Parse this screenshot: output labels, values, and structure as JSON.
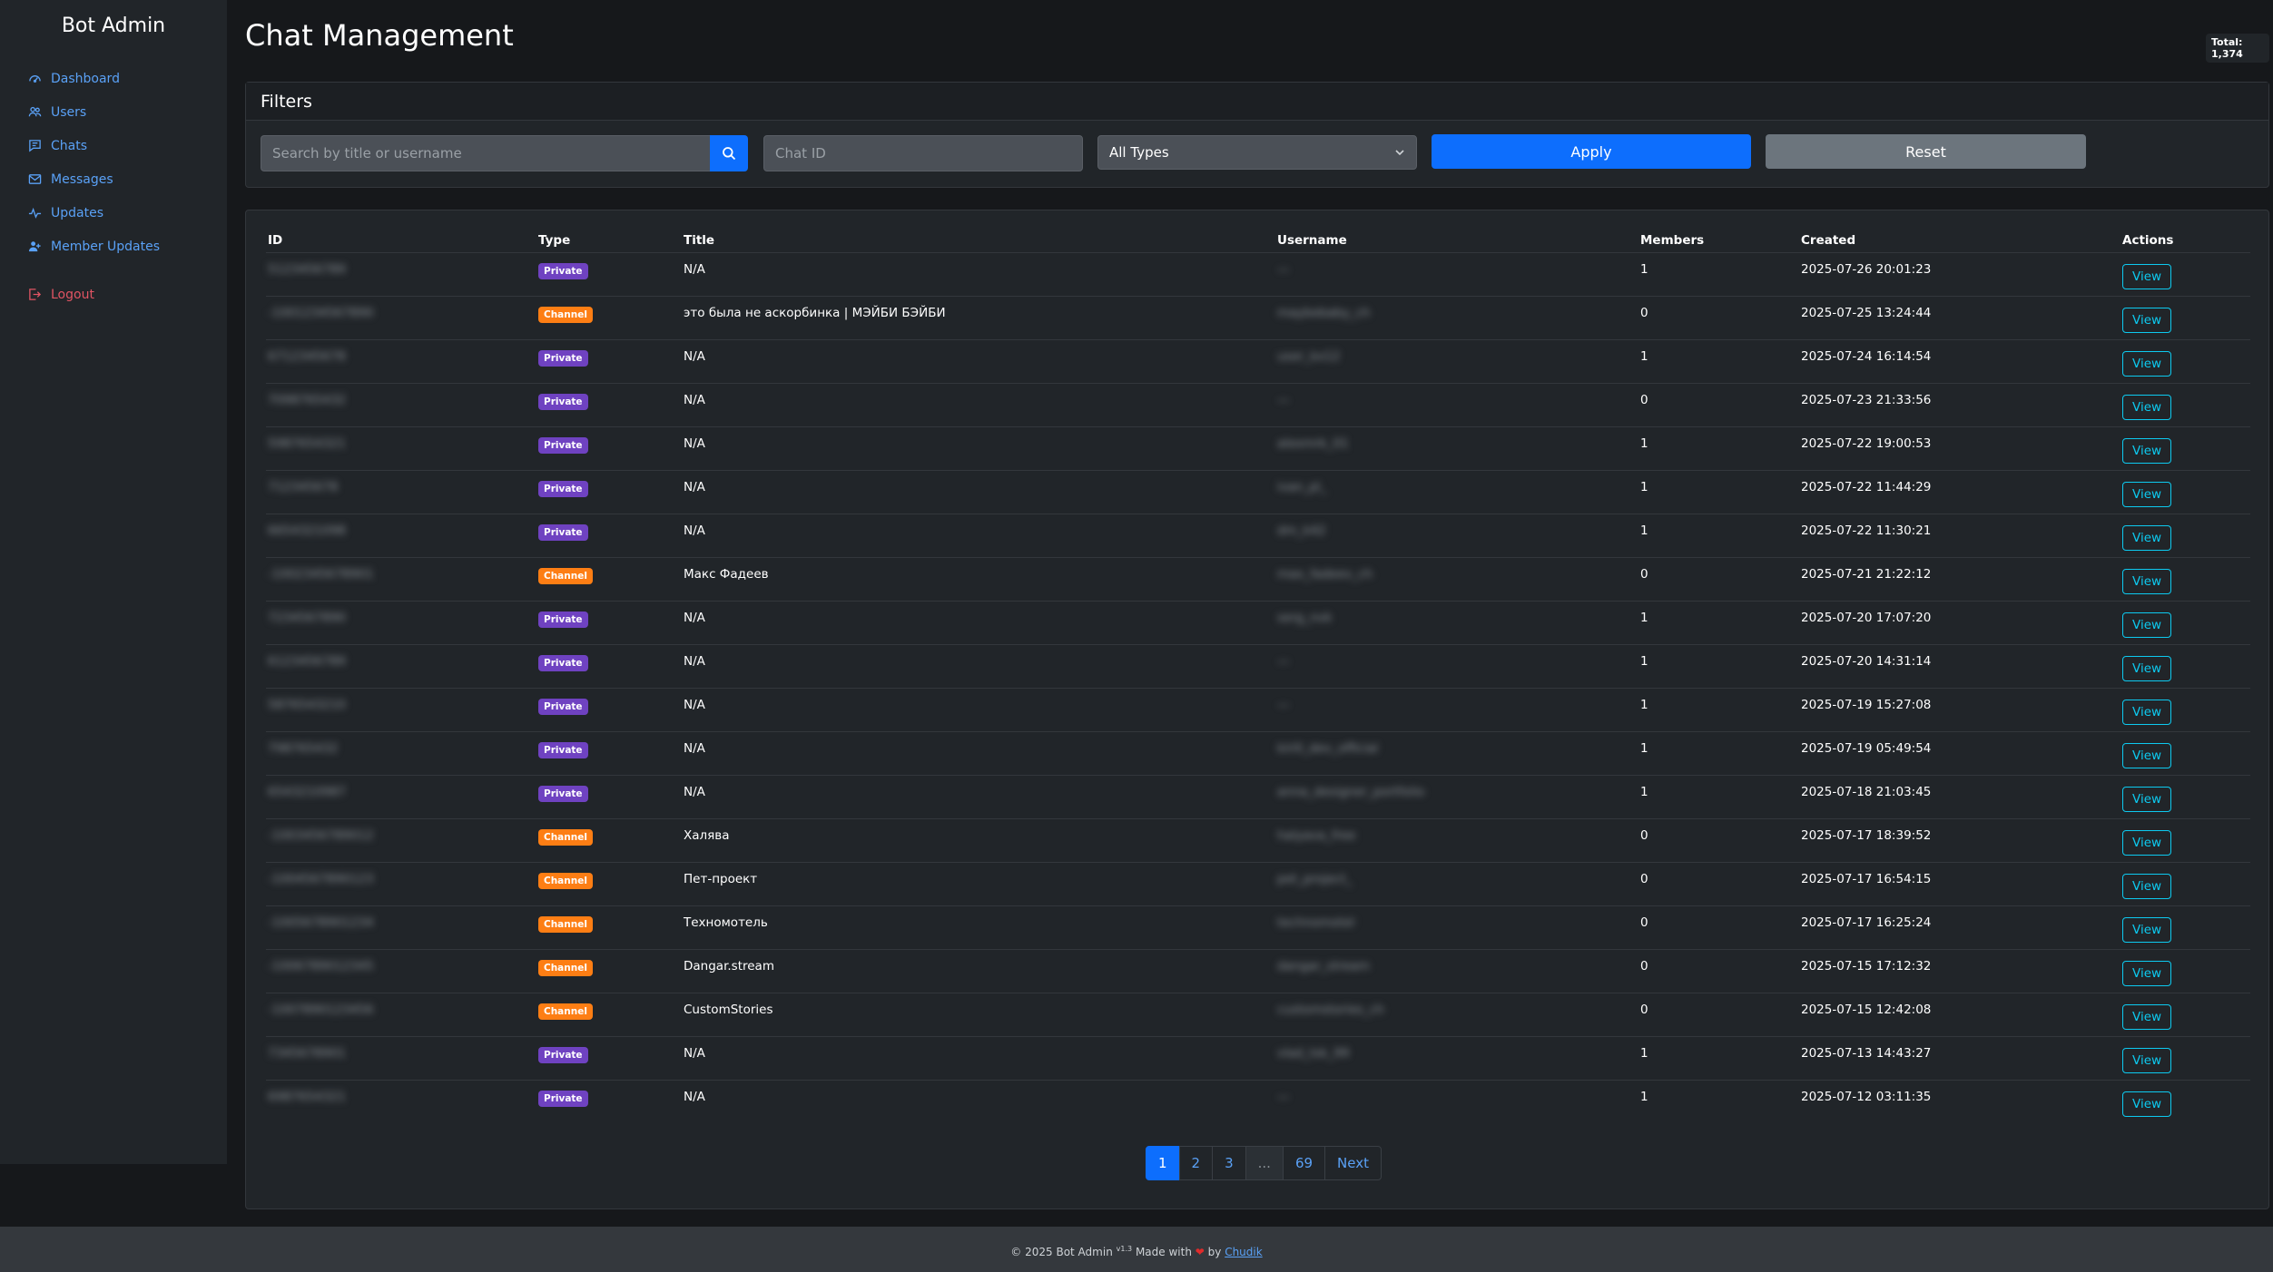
{
  "sidebar": {
    "brand": "Bot Admin",
    "items": [
      {
        "label": "Dashboard",
        "icon": "dashboard-icon"
      },
      {
        "label": "Users",
        "icon": "users-icon"
      },
      {
        "label": "Chats",
        "icon": "chats-icon"
      },
      {
        "label": "Messages",
        "icon": "envelope-icon"
      },
      {
        "label": "Updates",
        "icon": "pulse-icon"
      },
      {
        "label": "Member Updates",
        "icon": "member-icon"
      }
    ],
    "logout": {
      "label": "Logout",
      "icon": "logout-icon"
    }
  },
  "header": {
    "title": "Chat Management",
    "total": "Total: 1,374"
  },
  "filters": {
    "title": "Filters",
    "search_placeholder": "Search by title or username",
    "chat_id_placeholder": "Chat ID",
    "type_selected": "All Types",
    "apply_label": "Apply",
    "reset_label": "Reset"
  },
  "table": {
    "headers": [
      "ID",
      "Type",
      "Title",
      "Username",
      "Members",
      "Created",
      "Actions"
    ],
    "view_label": "View",
    "rows": [
      {
        "id": "5123456789",
        "type": "Private",
        "title": "N/A",
        "username": "—",
        "members": "1",
        "created": "2025-07-26 20:01:23"
      },
      {
        "id": "-1001234567890",
        "type": "Channel",
        "title": "это была не аскорбинка | МЭЙБИ БЭЙБИ",
        "username": "maybebaby_ch",
        "members": "0",
        "created": "2025-07-25 13:24:44"
      },
      {
        "id": "6712345678",
        "type": "Private",
        "title": "N/A",
        "username": "user_kx12",
        "members": "1",
        "created": "2025-07-24 16:14:54"
      },
      {
        "id": "7098765432",
        "type": "Private",
        "title": "N/A",
        "username": "—",
        "members": "0",
        "created": "2025-07-23 21:33:56"
      },
      {
        "id": "5987654321",
        "type": "Private",
        "title": "N/A",
        "username": "alexmrk_01",
        "members": "1",
        "created": "2025-07-22 19:00:53"
      },
      {
        "id": "712345678",
        "type": "Private",
        "title": "N/A",
        "username": "ivan_pl_",
        "members": "1",
        "created": "2025-07-22 11:44:29"
      },
      {
        "id": "6654321098",
        "type": "Private",
        "title": "N/A",
        "username": "dm_k42",
        "members": "1",
        "created": "2025-07-22 11:30:21"
      },
      {
        "id": "-1002345678901",
        "type": "Channel",
        "title": "Макс Фадеев",
        "username": "max_fadeev_ch",
        "members": "0",
        "created": "2025-07-21 21:22:12"
      },
      {
        "id": "7234567890",
        "type": "Private",
        "title": "N/A",
        "username": "serg_nvk",
        "members": "1",
        "created": "2025-07-20 17:07:20"
      },
      {
        "id": "6123456789",
        "type": "Private",
        "title": "N/A",
        "username": "—",
        "members": "1",
        "created": "2025-07-20 14:31:14"
      },
      {
        "id": "5876543210",
        "type": "Private",
        "title": "N/A",
        "username": "—",
        "members": "1",
        "created": "2025-07-19 15:27:08"
      },
      {
        "id": "798765432",
        "type": "Private",
        "title": "N/A",
        "username": "kirill_dev_official",
        "members": "1",
        "created": "2025-07-19 05:49:54"
      },
      {
        "id": "6543210987",
        "type": "Private",
        "title": "N/A",
        "username": "anna_designer_portfolio",
        "members": "1",
        "created": "2025-07-18 21:03:45"
      },
      {
        "id": "-1003456789012",
        "type": "Channel",
        "title": "Халява",
        "username": "halyava_free",
        "members": "0",
        "created": "2025-07-17 18:39:52"
      },
      {
        "id": "-1004567890123",
        "type": "Channel",
        "title": "Пет-проект",
        "username": "pet_project_",
        "members": "0",
        "created": "2025-07-17 16:54:15"
      },
      {
        "id": "-1005678901234",
        "type": "Channel",
        "title": "Техномотель",
        "username": "technomotel",
        "members": "0",
        "created": "2025-07-17 16:25:24"
      },
      {
        "id": "-1006789012345",
        "type": "Channel",
        "title": "Dangar.stream",
        "username": "dangar_stream",
        "members": "0",
        "created": "2025-07-15 17:12:32"
      },
      {
        "id": "-1007890123456",
        "type": "Channel",
        "title": "CustomStories",
        "username": "customstories_ch",
        "members": "0",
        "created": "2025-07-15 12:42:08"
      },
      {
        "id": "7345678901",
        "type": "Private",
        "title": "N/A",
        "username": "vlad_tsk_99",
        "members": "1",
        "created": "2025-07-13 14:43:27"
      },
      {
        "id": "6987654321",
        "type": "Private",
        "title": "N/A",
        "username": "—",
        "members": "1",
        "created": "2025-07-12 03:11:35"
      }
    ]
  },
  "pagination": {
    "pages": [
      "1",
      "2",
      "3",
      "...",
      "69"
    ],
    "next": "Next",
    "active": "1"
  },
  "footer": {
    "copy": "© 2025 Bot Admin",
    "version": "v1.3",
    "made": "Made with",
    "by": "by",
    "author": "Chudik"
  },
  "colors": {
    "primary": "#0d6efd",
    "private_badge": "#6f42c1",
    "channel_badge": "#fd7e14",
    "view_outline": "#0dcaf0",
    "logout": "#e05463"
  }
}
